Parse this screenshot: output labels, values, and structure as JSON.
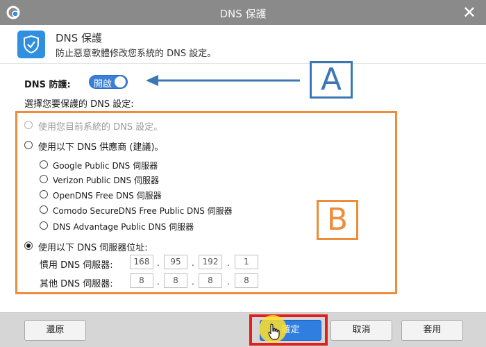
{
  "window": {
    "title": "DNS 保護"
  },
  "header": {
    "title": "DNS 保護",
    "description": "防止惡意軟體修改您系統的 DNS 設定。"
  },
  "dns_protection": {
    "label": "DNS 防護:",
    "toggle_text": "開啟",
    "enabled": true
  },
  "subtitle": "選擇您要保護的 DNS 設定:",
  "options": {
    "current": "使用您目前系統的 DNS 設定。",
    "provider": "使用以下 DNS 供應商 (建議)。",
    "providers": [
      "Google Public DNS 伺服器",
      "Verizon Public DNS 伺服器",
      "OpenDNS Free DNS 伺服器",
      "Comodo SecureDNS Free Public DNS 伺服器",
      "DNS Advantage Public DNS 伺服器"
    ],
    "custom": "使用以下 DNS 伺服器位址:"
  },
  "preferred_dns": {
    "label": "慣用 DNS 伺服器:",
    "octets": [
      "168",
      "95",
      "192",
      "1"
    ]
  },
  "alternate_dns": {
    "label": "其他 DNS 伺服器:",
    "octets": [
      "8",
      "8",
      "8",
      "8"
    ]
  },
  "annotations": {
    "a": "A",
    "b": "B"
  },
  "buttons": {
    "restore": "還原",
    "ok": "確定",
    "cancel": "取消",
    "apply": "套用"
  },
  "colors": {
    "titlebar": "#8a8a8a",
    "accent": "#2f7fe0",
    "annotation_blue": "#3a78b5",
    "annotation_orange": "#ee8c39",
    "highlight_red": "#e41e1e"
  },
  "icons": [
    "app-logo-icon",
    "close-icon",
    "shield-check-icon",
    "arrow-left-icon",
    "hand-cursor-icon"
  ]
}
